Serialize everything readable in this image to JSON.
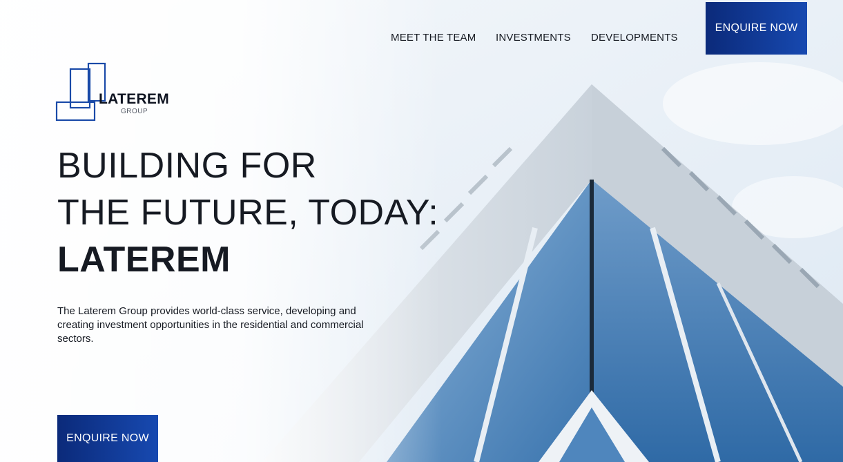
{
  "nav": {
    "items": [
      {
        "label": "MEET THE TEAM"
      },
      {
        "label": "INVESTMENTS"
      },
      {
        "label": "DEVELOPMENTS"
      }
    ],
    "cta_label": "ENQUIRE NOW"
  },
  "logo": {
    "name": "LATEREM",
    "sub": "GROUP",
    "icon": "building-blocks-logo-icon"
  },
  "hero": {
    "headline_line1": "BUILDING FOR",
    "headline_line2": "THE FUTURE, TODAY:",
    "headline_line3": "LATEREM",
    "description": "The Laterem Group provides world-class service, developing and creating investment opportunities in the residential and commercial sectors.",
    "cta_label": "ENQUIRE NOW",
    "background": "glass-building-photo"
  },
  "colors": {
    "accent_dark": "#0b2a7a",
    "accent_light": "#1749b0",
    "text": "#161a22",
    "logo_blue": "#1a4aa8"
  }
}
